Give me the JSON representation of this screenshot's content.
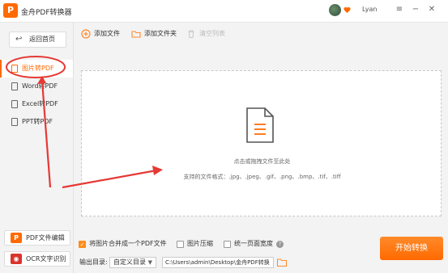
{
  "app": {
    "title": "金舟PDF转换器",
    "logo_glyph": "P",
    "username": "Lyan"
  },
  "window_controls": {
    "menu": "≡",
    "minimize": "−",
    "close": "✕"
  },
  "sidebar": {
    "back_label": "返回首页",
    "items": [
      {
        "label": "图片转PDF",
        "active": true
      },
      {
        "label": "Word转PDF",
        "active": false
      },
      {
        "label": "Excel转PDF",
        "active": false
      },
      {
        "label": "PPT转PDF",
        "active": false
      }
    ],
    "tools": [
      {
        "label": "PDF文件编辑",
        "badge": "P",
        "color": "#ff6a00"
      },
      {
        "label": "OCR文字识别",
        "badge": "◉",
        "color": "#d9342b"
      }
    ]
  },
  "toolbar": {
    "add_file": "添加文件",
    "add_folder": "添加文件夹",
    "clear_list": "清空列表"
  },
  "dropzone": {
    "hint": "点击或拖拽文件至此处",
    "formats": "支持的文件格式：.jpg、.jpeg、.gif、.png、.bmp、.tif、.tiff"
  },
  "options": {
    "merge_label": "将图片合并成一个PDF文件",
    "merge_checked": true,
    "compress_label": "图片压缩",
    "compress_checked": false,
    "uniform_label": "统一页面宽度",
    "uniform_checked": false,
    "help": "?"
  },
  "output": {
    "label": "输出目录:",
    "mode": "自定义目录",
    "path": "C:\\Users\\admin\\Desktop\\金舟PDF转换"
  },
  "start_button": "开始转换",
  "colors": {
    "accent": "#ff6a00",
    "annotation": "#e53935"
  }
}
